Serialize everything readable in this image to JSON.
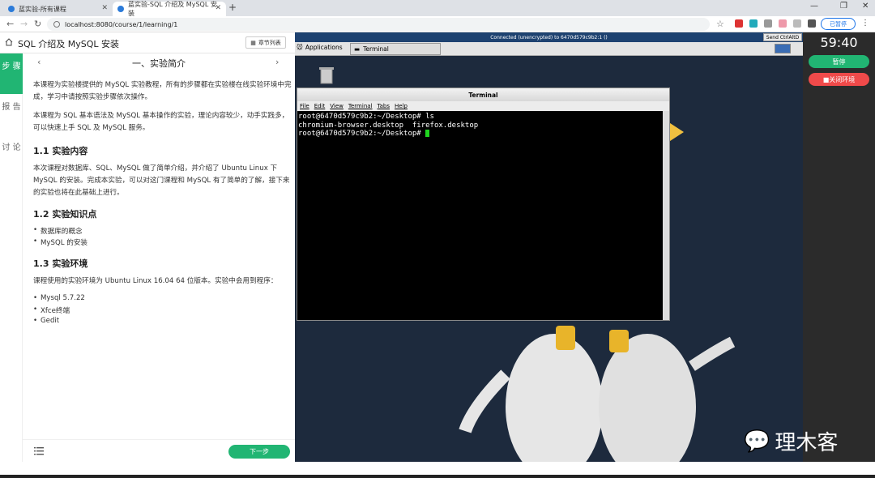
{
  "browser": {
    "tabs": [
      {
        "label": "蓝实验-所有课程"
      },
      {
        "label": "蓝实验-SQL 介绍及 MySQL 安装"
      }
    ],
    "url": "localhost:8080/course/1/learning/1",
    "paused_label": "已暂停"
  },
  "lesson": {
    "title": "SQL 介绍及 MySQL 安装",
    "toc_button": "章节列表",
    "side_tabs": {
      "steps": "步 骤",
      "report": "报 告",
      "discuss": "讨 论"
    },
    "section_title": "一、实验简介",
    "intro_p1": "本课程为实验楼提供的 MySQL 实验教程，所有的步骤都在实验楼在线实验环境中完成，学习中请按照实验步骤依次操作。",
    "intro_p2": "本课程为 SQL 基本语法及 MySQL 基本操作的实验，理论内容较少，动手实践多，可以快速上手 SQL 及 MySQL 服务。",
    "h_content": "1.1 实验内容",
    "content_p": "本次课程对数据库、SQL、MySQL 做了简单介绍，并介绍了 Ubuntu Linux 下 MySQL 的安装。完成本实验，可以对这门课程和 MySQL 有了简单的了解，接下来的实验也将在此基础上进行。",
    "h_knowledge": "1.2 实验知识点",
    "knowledge": [
      "数据库的概念",
      "MySQL 的安装"
    ],
    "h_env": "1.3 实验环境",
    "env_p": "课程使用的实验环境为 Ubuntu Linux 16.04 64 位版本。实验中会用到程序：",
    "env_items": [
      "Mysql 5.7.22",
      "Xfce终端",
      "Gedit"
    ],
    "next_button": "下一步"
  },
  "vnc": {
    "status": "Connected (unencrypted) to 6470d579c9b2:1 ()",
    "send_ctrl": "Send CtrlAltD",
    "applications": "Applications",
    "taskbar_terminal": "Terminal"
  },
  "terminal": {
    "title": "Terminal",
    "menu": [
      "File",
      "Edit",
      "View",
      "Terminal",
      "Tabs",
      "Help"
    ],
    "line1": "root@6470d579c9b2:~/Desktop# ls",
    "line2": "chromium-browser.desktop  firefox.desktop",
    "line3": "root@6470d579c9b2:~/Desktop# "
  },
  "timer": {
    "value": "59:40",
    "pause": "暂停",
    "close": "■关闭环境"
  },
  "watermark": "理木客"
}
